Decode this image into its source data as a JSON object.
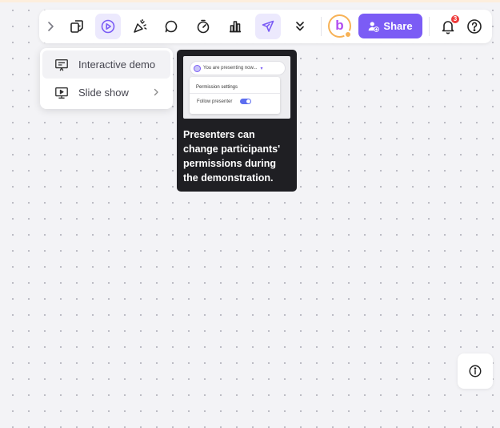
{
  "toolbar": {
    "icons": [
      "chevron-right-icon",
      "sticky-notes-icon",
      "present-play-icon",
      "celebrate-icon",
      "comment-icon",
      "timer-icon",
      "vote-icon",
      "laser-pointer-icon",
      "double-chevron-down-icon"
    ],
    "avatar_letter": "b",
    "share_label": "Share",
    "notification_count": "3",
    "accent_color": "#7b5cf5"
  },
  "present_menu": {
    "items": [
      {
        "label": "Interactive demo",
        "icon": "presentation-board-icon"
      },
      {
        "label": "Slide show",
        "icon": "slideshow-icon",
        "has_submenu": true
      }
    ]
  },
  "tooltip": {
    "preview": {
      "presenting_label": "You are presenting now...",
      "panel_title": "Permission settings",
      "follow_label": "Follow presenter",
      "follow_enabled": true
    },
    "text": "Presenters can change participants' permissions during the demonstration."
  },
  "info_button": {
    "icon": "info-icon"
  }
}
